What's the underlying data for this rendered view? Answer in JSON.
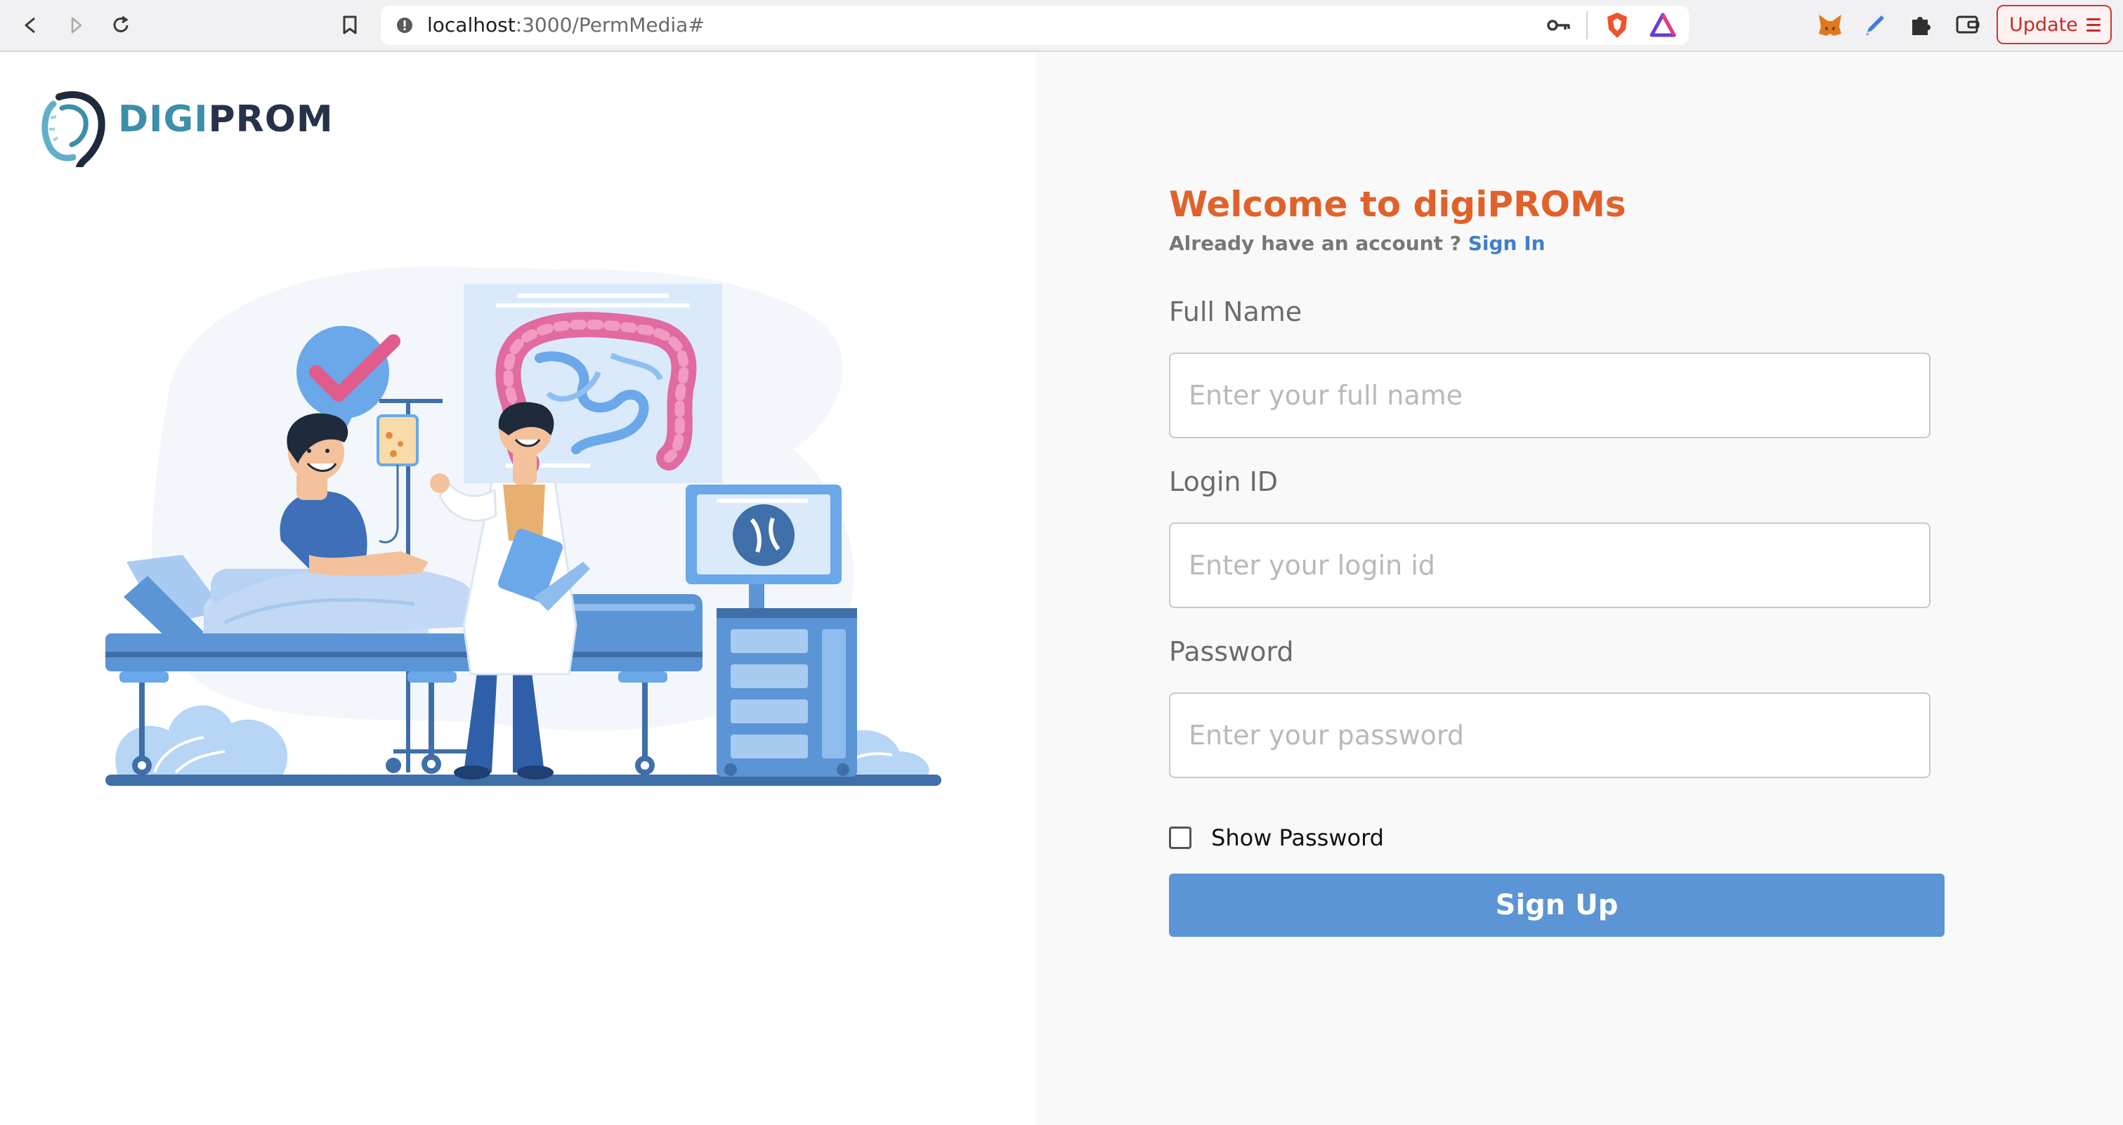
{
  "browser": {
    "url_host": "localhost",
    "url_path": ":3000/PermMedia#",
    "update_label": "Update"
  },
  "logo": {
    "part1": "DIGI",
    "part2": "PROM"
  },
  "form": {
    "title": "Welcome to digiPROMs",
    "account_prompt": "Already have an account ?",
    "sign_in_link": "Sign In",
    "full_name_label": "Full Name",
    "full_name_placeholder": "Enter your full name",
    "login_id_label": "Login ID",
    "login_id_placeholder": "Enter your login id",
    "password_label": "Password",
    "password_placeholder": "Enter your password",
    "show_password_label": "Show Password",
    "submit_label": "Sign Up"
  },
  "colors": {
    "accent": "#e0622a",
    "button": "#5b95d5",
    "link": "#3f7fcc"
  }
}
